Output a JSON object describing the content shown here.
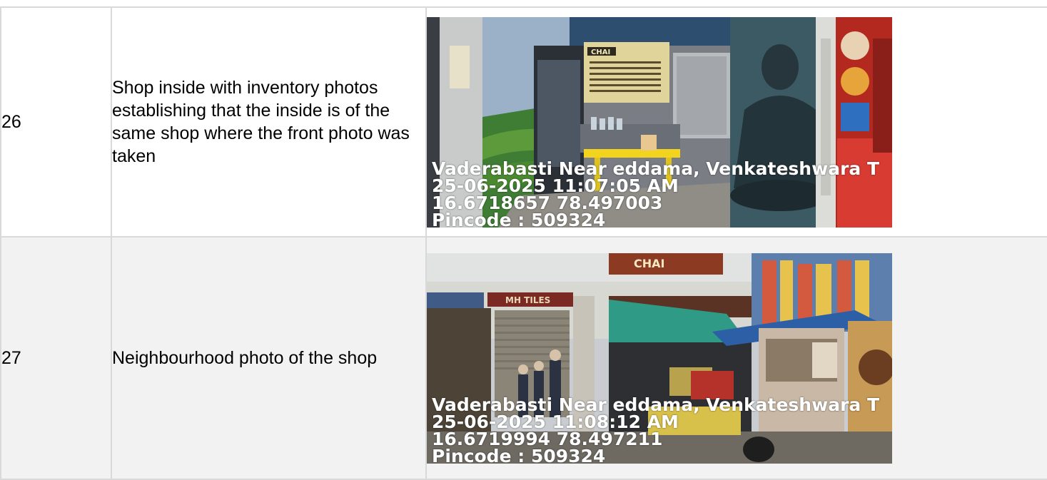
{
  "rows": [
    {
      "number": "26",
      "description": "Shop inside with inventory photos establishing that the inside is of the same shop where the front photo was taken",
      "photo": {
        "caption_lines": [
          "Vaderabasti Near eddama, Venkateshwara T",
          "25-06-2025 11:07:05 AM",
          "16.6718657 78.497003",
          "Pincode : 509324"
        ],
        "signage": [
          "CHAI"
        ]
      }
    },
    {
      "number": "27",
      "description": "Neighbourhood photo of the shop",
      "photo": {
        "caption_lines": [
          "Vaderabasti Near eddama, Venkateshwara T",
          "25-06-2025 11:08:12 AM",
          "16.6719994 78.497211",
          "Pincode : 509324"
        ],
        "signage": [
          "CHAI",
          "MH TILES"
        ]
      }
    }
  ]
}
